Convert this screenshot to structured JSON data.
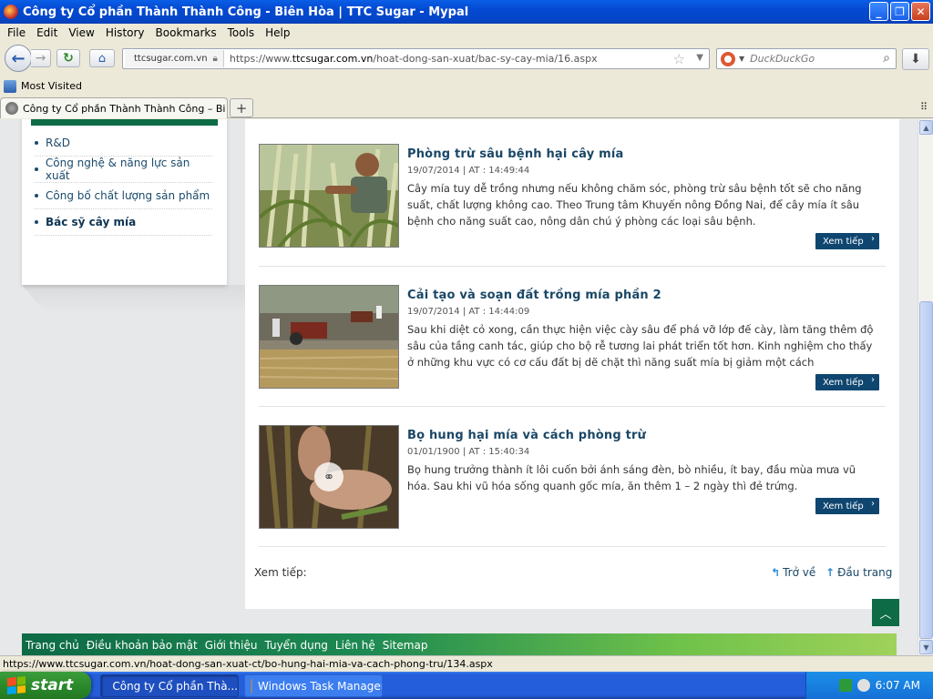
{
  "window": {
    "title": "Công ty Cổ phần Thành Thành Công - Biên Hòa  |  TTC Sugar - Mypal"
  },
  "menu": [
    "File",
    "Edit",
    "View",
    "History",
    "Bookmarks",
    "Tools",
    "Help"
  ],
  "navbar": {
    "site_identity": "ttcsugar.com.vn",
    "url_prefix": "https://www.",
    "url_domain": "ttcsugar.com.vn",
    "url_path": "/hoat-dong-san-xuat/bac-sy-cay-mia/16.aspx",
    "search_placeholder": "DuckDuckGo"
  },
  "bookmarks": {
    "most_visited": "Most Visited"
  },
  "tab": {
    "label": "Công ty Cổ phần Thành Thành Công – Biên ..."
  },
  "sidebar": {
    "items": [
      {
        "label": "R&D",
        "active": false
      },
      {
        "label": "Công nghệ & năng lực sản xuất",
        "active": false
      },
      {
        "label": "Công bố chất lượng sản phẩm",
        "active": false
      },
      {
        "label": "Bác sỹ cây mía",
        "active": true
      }
    ]
  },
  "articles": [
    {
      "title": "Phòng trừ sâu bệnh hại cây mía",
      "date": "19/07/2014 | AT : 14:49:44",
      "desc": "Cây mía tuy dễ trồng nhưng nếu không chăm sóc, phòng trừ sâu bệnh tốt sẽ cho năng suất, chất lượng không cao. Theo Trung tâm Khuyến nông Đồng Nai, để cây mía ít sâu bệnh cho năng suất cao, nông dân chú ý phòng các loại sâu bệnh.",
      "more": "Xem tiếp"
    },
    {
      "title": "Cải tạo và soạn đất trồng mía phần 2",
      "date": "19/07/2014 | AT : 14:44:09",
      "desc": "Sau khi diệt cỏ xong, cần thực hiện việc cày sâu để phá vỡ lớp đế cày, làm tăng thêm độ sâu của tầng canh tác, giúp cho bộ rễ tương lai phát triển tốt hơn. Kinh nghiệm cho thấy ở những khu vực có cơ cấu đất bị dẽ chặt thì năng suất mía bị giảm một cách",
      "more": "Xem tiếp"
    },
    {
      "title": "Bọ hung hại mía và cách phòng trừ",
      "date": "01/01/1900 | AT : 15:40:34",
      "desc": "Bọ hung trưởng thành ít lôi cuốn bởi ánh sáng đèn, bò nhiều, ít bay, đầu mùa mưa vũ hóa. Sau khi vũ hóa sống quanh gốc mía, ăn thêm 1 – 2 ngày thì đẻ trứng.",
      "more": "Xem tiếp"
    }
  ],
  "pager": {
    "label": "Xem tiếp:",
    "back": "Trở về",
    "top": "Đầu trang"
  },
  "footer_links": [
    "Trang chủ",
    "Điều khoản bảo mật",
    "Giới thiệu",
    "Tuyển dụng",
    "Liên hệ",
    "Sitemap"
  ],
  "status": {
    "url": "https://www.ttcsugar.com.vn/hoat-dong-san-xuat-ct/bo-hung-hai-mia-va-cach-phong-tru/134.aspx"
  },
  "taskbar": {
    "start": "start",
    "tasks": [
      "Công ty Cổ phần Thà...",
      "Windows Task Manager"
    ],
    "clock": "6:07 AM"
  },
  "colors": {
    "brand_green": "#0d6b45",
    "link_blue": "#1a4766",
    "button_navy": "#0f4670"
  }
}
